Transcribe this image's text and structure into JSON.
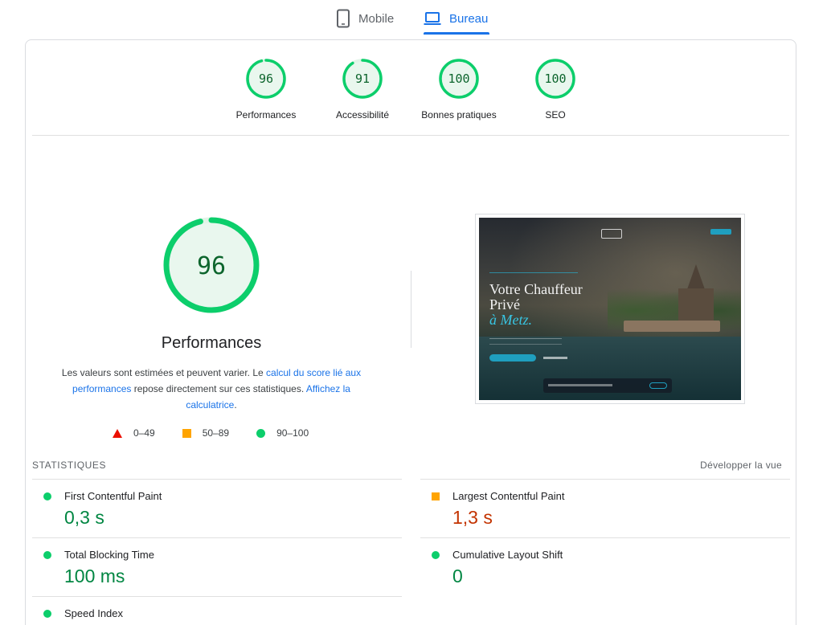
{
  "device_tabs": [
    {
      "label": "Mobile",
      "icon": "phone-icon",
      "active": false
    },
    {
      "label": "Bureau",
      "icon": "laptop-icon",
      "active": true
    }
  ],
  "categories": [
    {
      "score": "96",
      "label": "Performances",
      "fraction": 0.96
    },
    {
      "score": "91",
      "label": "Accessibilité",
      "fraction": 0.91
    },
    {
      "score": "100",
      "label": "Bonnes pratiques",
      "fraction": 1.0
    },
    {
      "score": "100",
      "label": "SEO",
      "fraction": 1.0
    }
  ],
  "performance": {
    "score": "96",
    "fraction": 0.96,
    "title": "Performances",
    "desc_prefix": "Les valeurs sont estimées et peuvent varier. Le ",
    "desc_link1": "calcul du score lié aux performances",
    "desc_middle": " repose directement sur ces statistiques. ",
    "desc_link2": "Affichez la calculatrice",
    "desc_suffix": "."
  },
  "legend": [
    {
      "shape": "triangle",
      "range": "0–49",
      "color": "#eb0f00"
    },
    {
      "shape": "square",
      "range": "50–89",
      "color": "#ffa400"
    },
    {
      "shape": "circle",
      "range": "90–100",
      "color": "#0cce6b"
    }
  ],
  "screenshot": {
    "headline_1": "Votre Chauffeur",
    "headline_2": "Privé",
    "headline_3": "à Metz."
  },
  "stats": {
    "heading": "STATISTIQUES",
    "expand_label": "Développer la vue",
    "metrics": [
      {
        "name": "First Contentful Paint",
        "value": "0,3 s",
        "rating": "good"
      },
      {
        "name": "Largest Contentful Paint",
        "value": "1,3 s",
        "rating": "average"
      },
      {
        "name": "Total Blocking Time",
        "value": "100 ms",
        "rating": "good"
      },
      {
        "name": "Cumulative Layout Shift",
        "value": "0",
        "rating": "good"
      },
      {
        "name": "Speed Index",
        "value": "",
        "rating": "good"
      }
    ]
  },
  "colors": {
    "accent": "#1a73e8",
    "pass": "#0cce6b",
    "pass_text": "#018642",
    "average": "#ffa400",
    "average_text": "#c33300",
    "fail": "#eb0f00"
  }
}
